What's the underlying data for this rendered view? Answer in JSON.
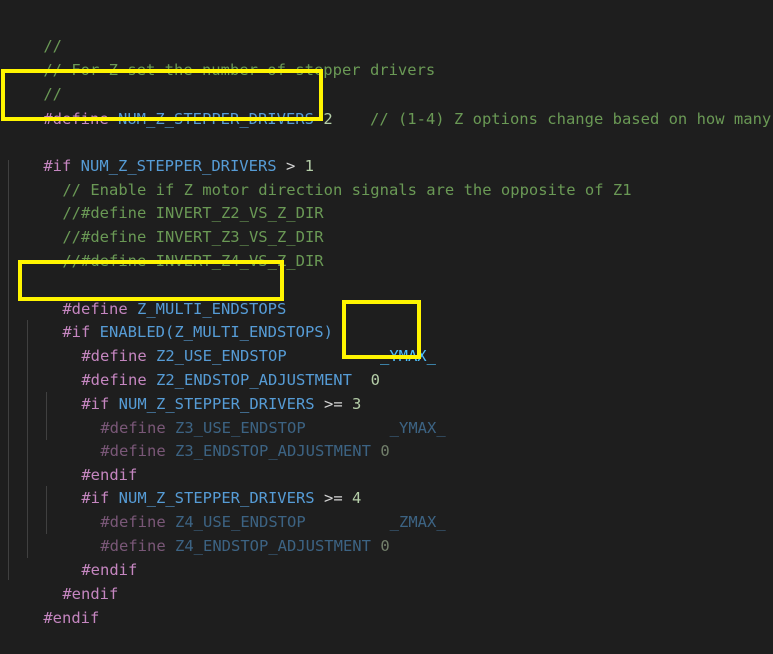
{
  "code": {
    "l01": "//",
    "l02": "// For Z set the number of stepper drivers",
    "l03": "//",
    "l04a": "#define",
    "l04b": "NUM_Z_STEPPER_DRIVERS",
    "l04c": "2",
    "l04d": "// (1-4) Z options change based on how many",
    "l05a": "#if",
    "l05b": "NUM_Z_STEPPER_DRIVERS",
    "l05c": ">",
    "l05d": "1",
    "l06": "// Enable if Z motor direction signals are the opposite of Z1",
    "l07": "//#define INVERT_Z2_VS_Z_DIR",
    "l08": "//#define INVERT_Z3_VS_Z_DIR",
    "l09": "//#define INVERT_Z4_VS_Z_DIR",
    "l10a": "#define",
    "l10b": "Z_MULTI_ENDSTOPS",
    "l11a": "#if",
    "l11b": "ENABLED(Z_MULTI_ENDSTOPS)",
    "l12a": "#define",
    "l12b": "Z2_USE_ENDSTOP",
    "l12c": "_YMAX_",
    "l13a": "#define",
    "l13b": "Z2_ENDSTOP_ADJUSTMENT",
    "l13c": "0",
    "l14a": "#if",
    "l14b": "NUM_Z_STEPPER_DRIVERS",
    "l14c": ">=",
    "l14d": "3",
    "l15a": "#define",
    "l15b": "Z3_USE_ENDSTOP",
    "l15c": "_YMAX_",
    "l16a": "#define",
    "l16b": "Z3_ENDSTOP_ADJUSTMENT",
    "l16c": "0",
    "l17": "#endif",
    "l18a": "#if",
    "l18b": "NUM_Z_STEPPER_DRIVERS",
    "l18c": ">=",
    "l18d": "4",
    "l19a": "#define",
    "l19b": "Z4_USE_ENDSTOP",
    "l19c": "_ZMAX_",
    "l20a": "#define",
    "l20b": "Z4_ENDSTOP_ADJUSTMENT",
    "l20c": "0",
    "l21": "#endif",
    "l22": "#endif",
    "l23": "#endif"
  },
  "colors": {
    "background": "#1e1e1e",
    "comment": "#6a9955",
    "preprocessor": "#c586c0",
    "identifier": "#569cd6",
    "number": "#b5cea8",
    "highlight_box": "#fff500"
  }
}
